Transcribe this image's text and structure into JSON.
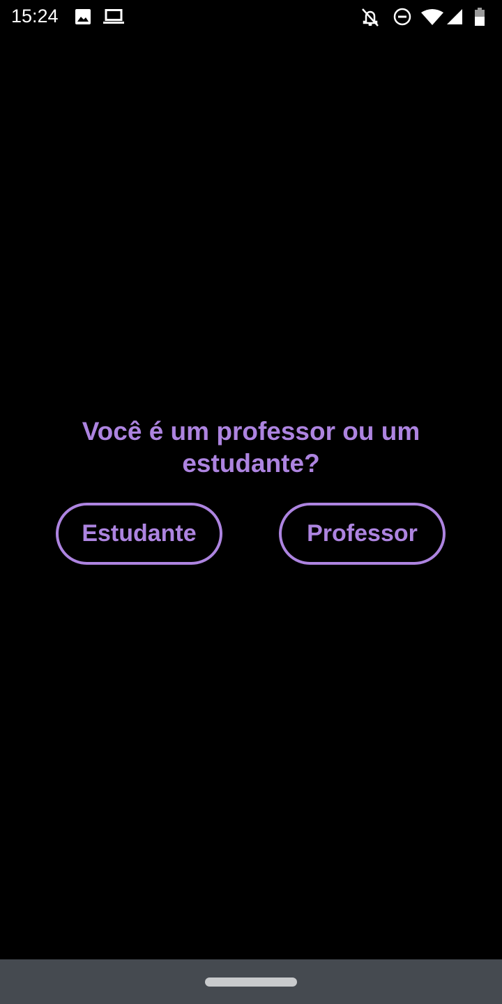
{
  "status_bar": {
    "time": "15:24",
    "left_icons": [
      "image-icon",
      "laptop-icon"
    ],
    "right_icons": [
      "notifications-off-icon",
      "do-not-disturb-icon",
      "wifi-icon",
      "cell-signal-icon",
      "battery-icon"
    ]
  },
  "main": {
    "question": "Você é um professor ou um estudante?",
    "student_button_label": "Estudante",
    "teacher_button_label": "Professor"
  },
  "colors": {
    "accent": "#ad84e0",
    "background": "#000000",
    "nav_bar": "#454a50"
  }
}
